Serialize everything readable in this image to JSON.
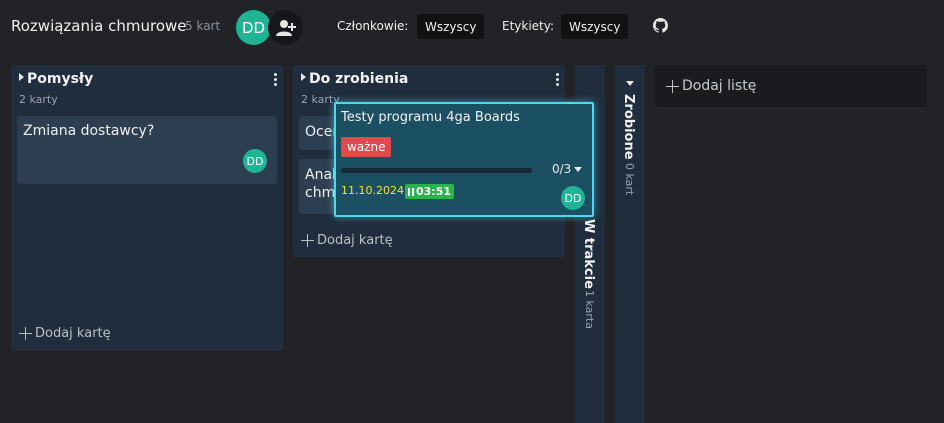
{
  "header": {
    "board_title": "Rozwiązania chmurowe",
    "card_count": "5 kart",
    "user_initials": "DD",
    "members_label": "Członkowie:",
    "members_value": "Wszyscy",
    "labels_label": "Etykiety:",
    "labels_value": "Wszyscy"
  },
  "lists": [
    {
      "title": "Pomysły",
      "count": "2 karty",
      "cards": [
        {
          "title": "Zmiana dostawcy?",
          "member": "DD"
        }
      ],
      "add_card": "Dodaj kartę"
    },
    {
      "title": "Do zrobienia",
      "count": "2 karty",
      "cards": [
        {
          "title": "Ocen"
        },
        {
          "title_line1": "Anal",
          "title_line2": "chm"
        }
      ],
      "add_card": "Dodaj kartę"
    }
  ],
  "collapsed_lists": [
    {
      "title": "W trakcie",
      "count": "1 karta"
    },
    {
      "title": "Zrobione",
      "count": "0 kart"
    }
  ],
  "add_list": "Dodaj listę",
  "dragged_card": {
    "title": "Testy programu 4ga Boards",
    "label": "ważne",
    "label_color": "#e3484e",
    "checklist_progress": 0,
    "checklist_text": "0/3",
    "due_date": "11.10.2024",
    "timer": "03:51",
    "member": "DD"
  },
  "colors": {
    "background": "#222326",
    "list_background": "#1f2d3d",
    "avatar": "#1fb493",
    "highlight": "#4fd8ee"
  }
}
